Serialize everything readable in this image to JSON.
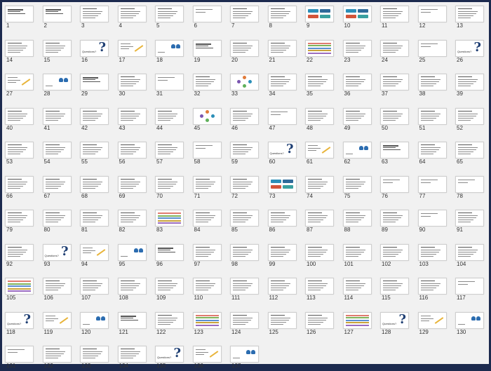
{
  "view": "slide-sorter",
  "total_slides": 137,
  "slides": [
    {
      "n": "1",
      "k": "title"
    },
    {
      "n": "2",
      "k": "title"
    },
    {
      "n": "3",
      "k": "text"
    },
    {
      "n": "4",
      "k": "text"
    },
    {
      "n": "5",
      "k": "text"
    },
    {
      "n": "6",
      "k": "short"
    },
    {
      "n": "7",
      "k": "text"
    },
    {
      "n": "8",
      "k": "text"
    },
    {
      "n": "9",
      "k": "flow"
    },
    {
      "n": "10",
      "k": "flow"
    },
    {
      "n": "11",
      "k": "text"
    },
    {
      "n": "12",
      "k": "short"
    },
    {
      "n": "13",
      "k": "text"
    },
    {
      "n": "14",
      "k": "text"
    },
    {
      "n": "15",
      "k": "text"
    },
    {
      "n": "16",
      "k": "question"
    },
    {
      "n": "17",
      "k": "pencil"
    },
    {
      "n": "18",
      "k": "people"
    },
    {
      "n": "19",
      "k": "title"
    },
    {
      "n": "20",
      "k": "text"
    },
    {
      "n": "21",
      "k": "text"
    },
    {
      "n": "22",
      "k": "strips"
    },
    {
      "n": "23",
      "k": "text"
    },
    {
      "n": "24",
      "k": "text"
    },
    {
      "n": "25",
      "k": "short"
    },
    {
      "n": "26",
      "k": "question"
    },
    {
      "n": "27",
      "k": "pencil"
    },
    {
      "n": "28",
      "k": "people"
    },
    {
      "n": "29",
      "k": "title"
    },
    {
      "n": "30",
      "k": "text"
    },
    {
      "n": "31",
      "k": "short"
    },
    {
      "n": "32",
      "k": "text"
    },
    {
      "n": "33",
      "k": "cycle"
    },
    {
      "n": "34",
      "k": "text"
    },
    {
      "n": "35",
      "k": "text"
    },
    {
      "n": "36",
      "k": "text"
    },
    {
      "n": "37",
      "k": "text"
    },
    {
      "n": "38",
      "k": "text"
    },
    {
      "n": "39",
      "k": "text"
    },
    {
      "n": "40",
      "k": "text"
    },
    {
      "n": "41",
      "k": "text"
    },
    {
      "n": "42",
      "k": "text"
    },
    {
      "n": "43",
      "k": "text"
    },
    {
      "n": "44",
      "k": "text"
    },
    {
      "n": "45",
      "k": "cycle"
    },
    {
      "n": "46",
      "k": "text"
    },
    {
      "n": "47",
      "k": "short"
    },
    {
      "n": "48",
      "k": "text"
    },
    {
      "n": "49",
      "k": "text"
    },
    {
      "n": "50",
      "k": "text"
    },
    {
      "n": "51",
      "k": "text"
    },
    {
      "n": "52",
      "k": "text"
    },
    {
      "n": "53",
      "k": "text"
    },
    {
      "n": "54",
      "k": "text"
    },
    {
      "n": "55",
      "k": "text"
    },
    {
      "n": "56",
      "k": "text"
    },
    {
      "n": "57",
      "k": "text"
    },
    {
      "n": "58",
      "k": "short"
    },
    {
      "n": "59",
      "k": "text"
    },
    {
      "n": "60",
      "k": "question"
    },
    {
      "n": "61",
      "k": "pencil"
    },
    {
      "n": "62",
      "k": "people"
    },
    {
      "n": "63",
      "k": "title"
    },
    {
      "n": "64",
      "k": "text"
    },
    {
      "n": "65",
      "k": "text"
    },
    {
      "n": "66",
      "k": "text"
    },
    {
      "n": "67",
      "k": "text"
    },
    {
      "n": "68",
      "k": "text"
    },
    {
      "n": "69",
      "k": "text"
    },
    {
      "n": "70",
      "k": "text"
    },
    {
      "n": "71",
      "k": "text"
    },
    {
      "n": "72",
      "k": "text"
    },
    {
      "n": "73",
      "k": "flow"
    },
    {
      "n": "74",
      "k": "text"
    },
    {
      "n": "75",
      "k": "text"
    },
    {
      "n": "76",
      "k": "short"
    },
    {
      "n": "77",
      "k": "short"
    },
    {
      "n": "78",
      "k": "short"
    },
    {
      "n": "79",
      "k": "text"
    },
    {
      "n": "80",
      "k": "text"
    },
    {
      "n": "81",
      "k": "text"
    },
    {
      "n": "82",
      "k": "text"
    },
    {
      "n": "83",
      "k": "strips"
    },
    {
      "n": "84",
      "k": "text"
    },
    {
      "n": "85",
      "k": "text"
    },
    {
      "n": "86",
      "k": "text"
    },
    {
      "n": "87",
      "k": "text"
    },
    {
      "n": "88",
      "k": "text"
    },
    {
      "n": "89",
      "k": "text"
    },
    {
      "n": "90",
      "k": "short"
    },
    {
      "n": "91",
      "k": "text"
    },
    {
      "n": "92",
      "k": "text"
    },
    {
      "n": "93",
      "k": "question"
    },
    {
      "n": "94",
      "k": "pencil"
    },
    {
      "n": "95",
      "k": "people"
    },
    {
      "n": "96",
      "k": "title"
    },
    {
      "n": "97",
      "k": "text"
    },
    {
      "n": "98",
      "k": "text"
    },
    {
      "n": "99",
      "k": "text"
    },
    {
      "n": "100",
      "k": "text"
    },
    {
      "n": "101",
      "k": "text"
    },
    {
      "n": "102",
      "k": "text"
    },
    {
      "n": "103",
      "k": "text"
    },
    {
      "n": "104",
      "k": "text"
    },
    {
      "n": "105",
      "k": "strips"
    },
    {
      "n": "106",
      "k": "text"
    },
    {
      "n": "107",
      "k": "text"
    },
    {
      "n": "108",
      "k": "text"
    },
    {
      "n": "109",
      "k": "text"
    },
    {
      "n": "110",
      "k": "text"
    },
    {
      "n": "111",
      "k": "text"
    },
    {
      "n": "112",
      "k": "text"
    },
    {
      "n": "113",
      "k": "text"
    },
    {
      "n": "114",
      "k": "text"
    },
    {
      "n": "115",
      "k": "text"
    },
    {
      "n": "116",
      "k": "text"
    },
    {
      "n": "117",
      "k": "short"
    },
    {
      "n": "118",
      "k": "question"
    },
    {
      "n": "119",
      "k": "pencil"
    },
    {
      "n": "120",
      "k": "people"
    },
    {
      "n": "121",
      "k": "title"
    },
    {
      "n": "122",
      "k": "text"
    },
    {
      "n": "123",
      "k": "strips"
    },
    {
      "n": "124",
      "k": "text"
    },
    {
      "n": "125",
      "k": "text"
    },
    {
      "n": "126",
      "k": "text"
    },
    {
      "n": "127",
      "k": "strips"
    },
    {
      "n": "128",
      "k": "question"
    },
    {
      "n": "129",
      "k": "pencil"
    },
    {
      "n": "130",
      "k": "people"
    },
    {
      "n": "131",
      "k": "short"
    },
    {
      "n": "132",
      "k": "text"
    },
    {
      "n": "133",
      "k": "text"
    },
    {
      "n": "134",
      "k": "text"
    },
    {
      "n": "135",
      "k": "question"
    },
    {
      "n": "136",
      "k": "pencil"
    },
    {
      "n": "137",
      "k": "people"
    }
  ],
  "question_label": "Questions?",
  "colors": {
    "flow": [
      "#2b8fb8",
      "#2f6b9a",
      "#d2553a",
      "#3aa0a0"
    ],
    "strips": [
      "#e07b6f",
      "#7fb35a",
      "#5b8fd0",
      "#c9a23a",
      "#9b6cc0"
    ],
    "cycle": [
      "#e07b3a",
      "#2b8fb8",
      "#5fb05a",
      "#7a55b0"
    ]
  }
}
